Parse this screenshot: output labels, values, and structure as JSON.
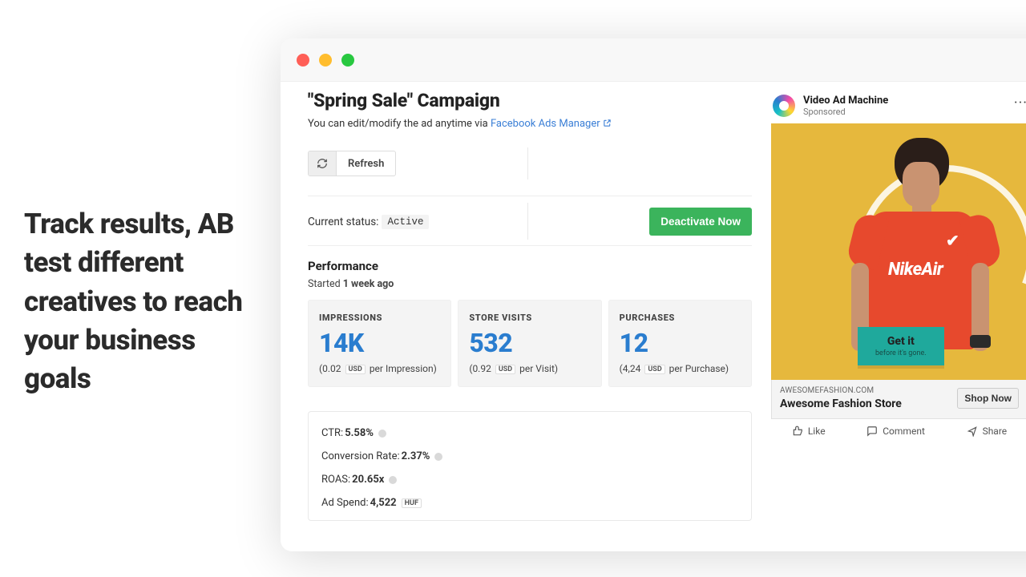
{
  "headline": "Track results, AB test different creatives to reach your business goals",
  "campaign": {
    "title": "\"Spring Sale\" Campaign",
    "subtext_prefix": "You can edit/modify the ad anytime via ",
    "subtext_link": "Facebook Ads Manager",
    "refresh_label": "Refresh",
    "status_label": "Current status:",
    "status_value": "Active",
    "deactivate_label": "Deactivate Now"
  },
  "performance": {
    "heading": "Performance",
    "started_prefix": "Started ",
    "started_value": "1 week ago",
    "cards": [
      {
        "label": "IMPRESSIONS",
        "value": "14K",
        "cost": "0.02",
        "currency": "USD",
        "unit": "per Impression"
      },
      {
        "label": "STORE VISITS",
        "value": "532",
        "cost": "0.92",
        "currency": "USD",
        "unit": "per Visit"
      },
      {
        "label": "PURCHASES",
        "value": "12",
        "cost": "4,24",
        "currency": "USD",
        "unit": "per Purchase"
      }
    ]
  },
  "stats": {
    "ctr_label": "CTR:",
    "ctr_value": "5.58%",
    "conv_label": "Conversion Rate:",
    "conv_value": "2.37%",
    "roas_label": "ROAS:",
    "roas_value": "20.65x",
    "spend_label": "Ad Spend:",
    "spend_value": "4,522",
    "spend_currency": "HUF"
  },
  "ad": {
    "page_name": "Video Ad Machine",
    "sponsored": "Sponsored",
    "shirt_text": "NikeAir",
    "cta_title": "Get it",
    "cta_sub": "before it's gone.",
    "domain": "AWESOMEFASHION.COM",
    "title": "Awesome Fashion Store",
    "shop_label": "Shop Now",
    "like": "Like",
    "comment": "Comment",
    "share": "Share"
  }
}
